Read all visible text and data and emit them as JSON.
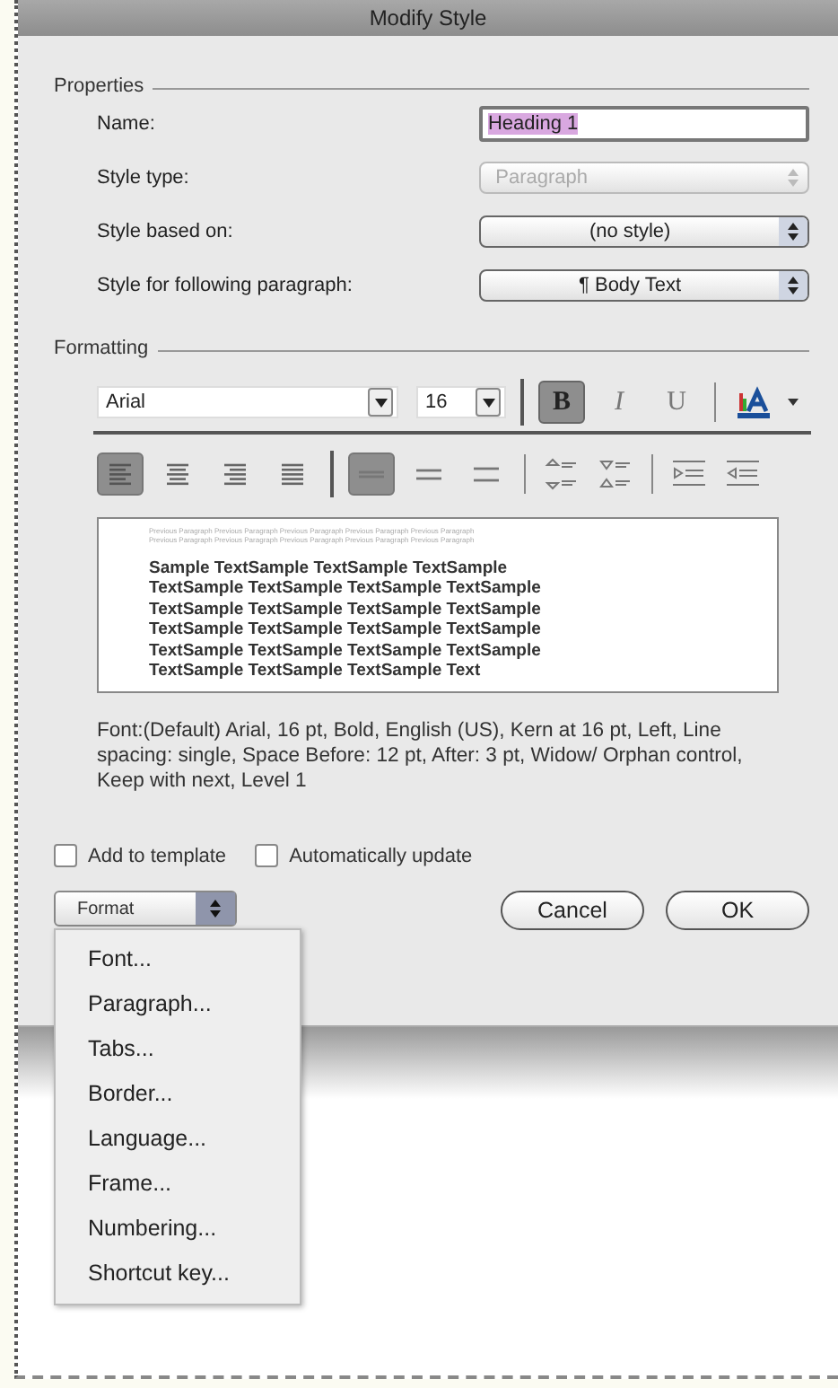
{
  "window": {
    "title": "Modify Style"
  },
  "properties": {
    "label": "Properties",
    "fields": [
      {
        "kind": "text",
        "label": "Name:",
        "value": "Heading 1",
        "highlighted": true
      },
      {
        "kind": "popup",
        "label": "Style type:",
        "value": "Paragraph",
        "disabled": true
      },
      {
        "kind": "popup",
        "label": "Style based on:",
        "value": "(no style)",
        "disabled": false
      },
      {
        "kind": "popup",
        "label": "Style for following paragraph:",
        "value": "¶ Body Text",
        "disabled": false
      }
    ]
  },
  "formatting": {
    "label": "Formatting",
    "font": "Arial",
    "size": "16",
    "styles": [
      {
        "kind": "bold",
        "label": "B",
        "selected": true
      },
      {
        "kind": "italic",
        "label": "I",
        "selected": false
      },
      {
        "kind": "underline",
        "label": "U",
        "selected": false
      }
    ],
    "alignment": [
      {
        "kind": "left",
        "selected": true
      },
      {
        "kind": "center",
        "selected": false
      },
      {
        "kind": "right",
        "selected": false
      },
      {
        "kind": "justify",
        "selected": false
      }
    ],
    "spacing": [
      {
        "kind": "single",
        "selected": true
      },
      {
        "kind": "one-half",
        "selected": false
      },
      {
        "kind": "double",
        "selected": false
      }
    ]
  },
  "preview": {
    "previous": [
      "Previous Paragraph Previous Paragraph Previous Paragraph Previous Paragraph Previous Paragraph",
      "Previous Paragraph Previous Paragraph Previous Paragraph Previous Paragraph Previous Paragraph"
    ],
    "lines": [
      "Sample TextSample TextSample TextSample",
      "TextSample TextSample TextSample TextSample",
      "TextSample TextSample TextSample TextSample",
      "TextSample TextSample TextSample TextSample",
      "TextSample TextSample TextSample TextSample",
      "TextSample TextSample TextSample Text"
    ]
  },
  "description": "Font:(Default) Arial, 16 pt, Bold, English (US), Kern at 16 pt, Left, Line spacing:  single, Space Before:  12 pt, After:  3 pt, Widow/ Orphan control, Keep with next, Level 1",
  "options": [
    {
      "label": "Add to template",
      "checked": false
    },
    {
      "label": "Automatically update",
      "checked": false
    }
  ],
  "format_button": "Format",
  "format_menu": [
    "Font...",
    "Paragraph...",
    "Tabs...",
    "Border...",
    "Language...",
    "Frame...",
    "Numbering...",
    "Shortcut key..."
  ],
  "buttons": [
    "Cancel",
    "OK"
  ]
}
